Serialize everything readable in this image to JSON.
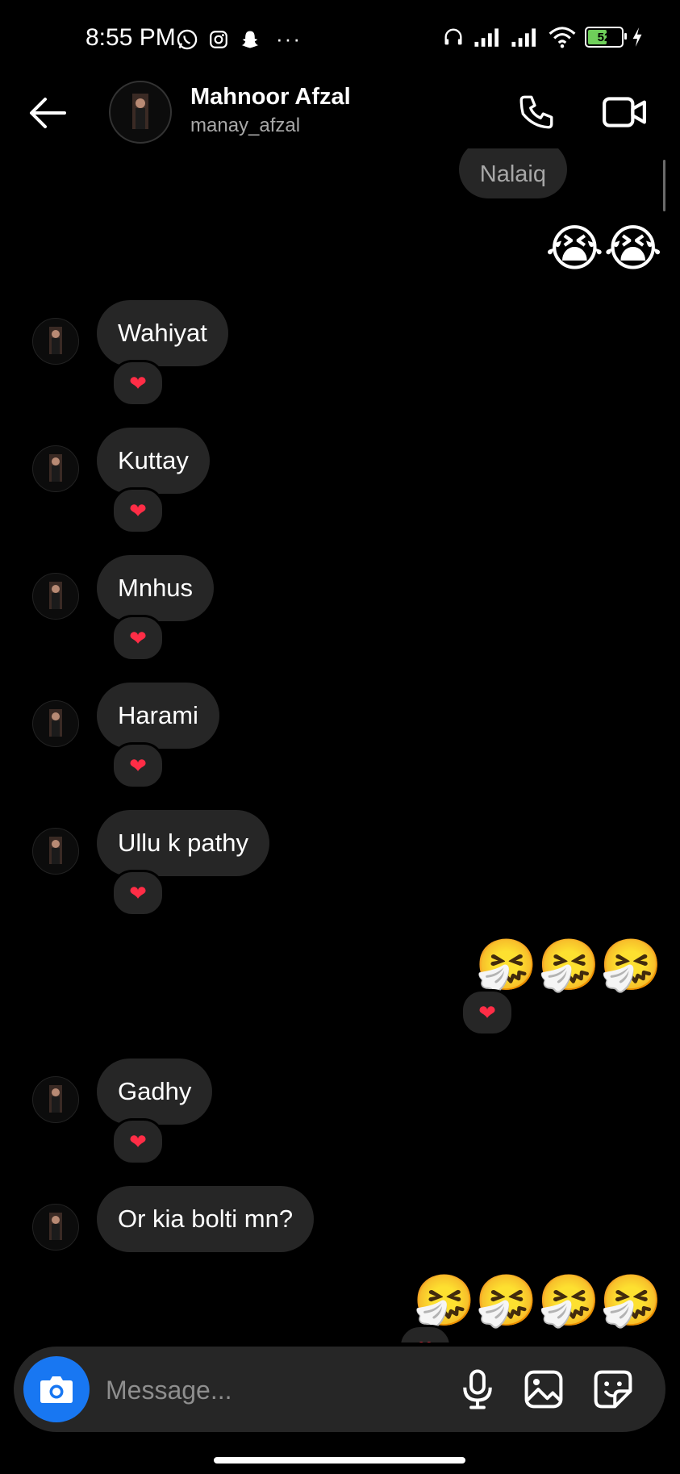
{
  "status_bar": {
    "time": "8:55 PM",
    "left_icons": [
      "whatsapp-icon",
      "instagram-icon",
      "snapchat-icon",
      "more-dots-icon"
    ],
    "right_icons": [
      "headphones-icon",
      "signal-icon",
      "signal-icon",
      "wifi-icon",
      "battery-icon",
      "charging-icon"
    ],
    "battery_level": "52"
  },
  "header": {
    "name": "Mahnoor Afzal",
    "username": "manay_afzal"
  },
  "messages": {
    "outgoing_partial": "Nalaiq",
    "outgoing_emoji_1": "😭😭",
    "incoming": [
      {
        "text": "Wahiyat",
        "reaction": "❤"
      },
      {
        "text": "Kuttay",
        "reaction": "❤"
      },
      {
        "text": "Mnhus",
        "reaction": "❤"
      },
      {
        "text": "Harami",
        "reaction": "❤"
      },
      {
        "text": "Ullu k pathy",
        "reaction": "❤"
      }
    ],
    "outgoing_emoji_2": "🤧🤧🤧",
    "outgoing_emoji_2_reaction": "❤",
    "incoming_2": [
      {
        "text": "Gadhy",
        "reaction": "❤"
      },
      {
        "text": "Or kia bolti mn?"
      }
    ],
    "outgoing_emoji_3": "🤧🤧🤧🤧",
    "outgoing_emoji_3_reaction": "❤"
  },
  "composer": {
    "placeholder": "Message..."
  },
  "colors": {
    "background": "#000000",
    "bubble": "#262626",
    "accent": "#1877f2",
    "reaction": "#ff2d46"
  }
}
